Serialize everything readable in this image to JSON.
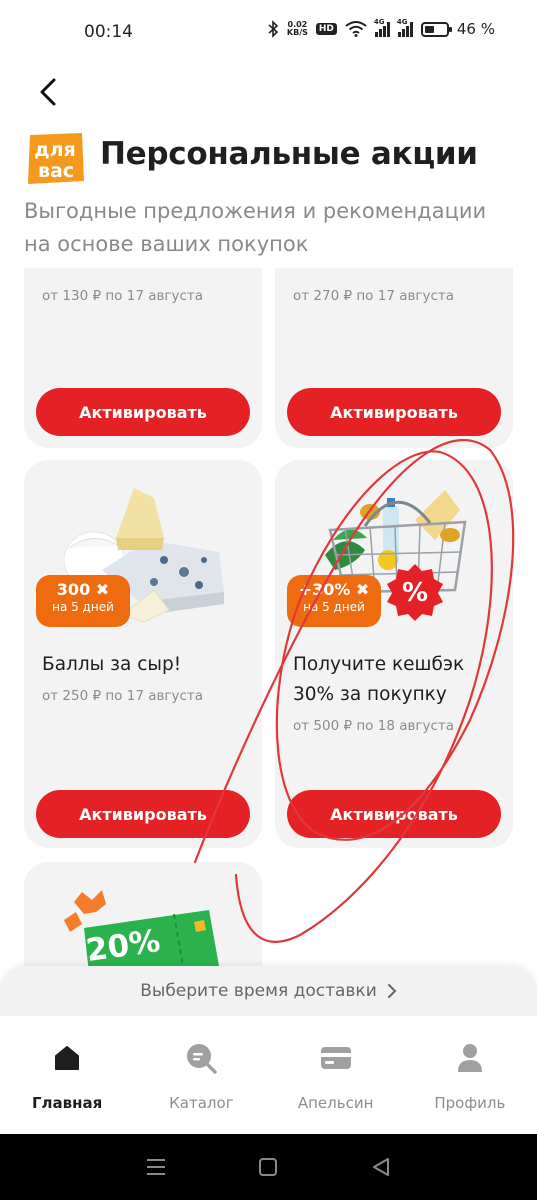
{
  "status_bar": {
    "time": "00:14",
    "net_speed_value": "0.02",
    "net_speed_unit": "KB/S",
    "hd": "HD",
    "signal_tag": "4G",
    "battery_percent_label": "46 %",
    "battery_level": 0.46
  },
  "header": {
    "logo_line1": "для",
    "logo_line2": "вас",
    "title": "Персональные акции",
    "subtitle": "Выгодные предложения и рекомендации на основе ваших покупок"
  },
  "offers": [
    {
      "validity": "от 130 ₽ по 17 августа",
      "button": "Активировать"
    },
    {
      "validity": "от 270 ₽ по 17 августа",
      "button": "Активировать"
    },
    {
      "title": "Баллы за сыр!",
      "validity": "от 250 ₽ по 17 августа",
      "button": "Активировать",
      "badge_value": "300",
      "badge_sub": "на 5 дней",
      "image": "cheese-illustration"
    },
    {
      "title": "Получите кешбэк 30% за покупку",
      "validity": "от 500 ₽ по 18 августа",
      "button": "Активировать",
      "badge_value": "+30%",
      "badge_sub": "на 5 дней",
      "percent_sign": "%",
      "image": "grocery-basket-illustration"
    },
    {
      "badge_value": "20%",
      "image": "discount-ticket-illustration"
    }
  ],
  "delivery_bar": {
    "label": "Выберите время доставки"
  },
  "bottom_nav": [
    {
      "label": "Главная",
      "icon": "home-icon",
      "active": true
    },
    {
      "label": "Каталог",
      "icon": "catalog-search-icon",
      "active": false
    },
    {
      "label": "Апельсин",
      "icon": "card-icon",
      "active": false
    },
    {
      "label": "Профиль",
      "icon": "profile-icon",
      "active": false
    }
  ],
  "colors": {
    "accent_red": "#e42125",
    "badge_orange": "#ef6b0f",
    "logo_orange": "#f39a1e",
    "card_bg": "#f3f3f3",
    "text_muted": "#8a8a8a",
    "annotation_red": "#e0383b"
  }
}
